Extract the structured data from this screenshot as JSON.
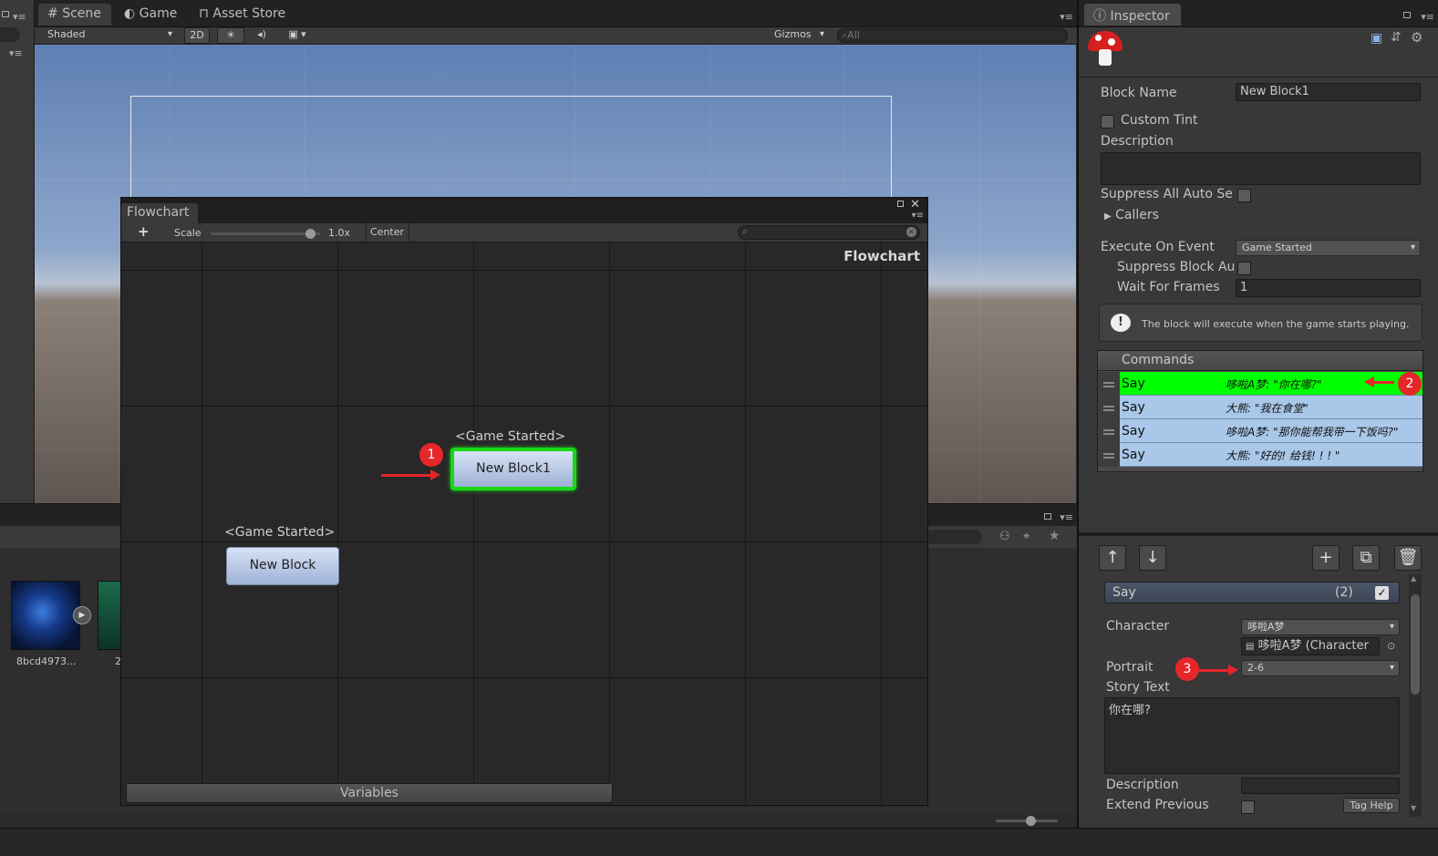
{
  "scene_window": {
    "tabs": [
      "Scene",
      "Game",
      "Asset Store"
    ],
    "shading_mode": "Shaded",
    "mode_2d": "2D",
    "gizmos_label": "Gizmos",
    "search_placeholder": "All"
  },
  "flowchart_window": {
    "tab": "Flowchart",
    "add_button": "+",
    "scale_label": "Scale",
    "scale_value": "1.0x",
    "scale_fraction": 0.95,
    "center_button": "Center",
    "corner_title": "Flowchart",
    "variables_button": "Variables",
    "blocks": [
      {
        "event": "<Game Started>",
        "name": "New Block1",
        "selected": true
      },
      {
        "event": "<Game Started>",
        "name": "New Block",
        "selected": false
      }
    ]
  },
  "project_panel": {
    "assets": [
      {
        "label": "8bcd4973..."
      },
      {
        "label": "2"
      }
    ]
  },
  "inspector": {
    "tab": "Inspector",
    "block_name_label": "Block Name",
    "block_name_value": "New Block1",
    "custom_tint_label": "Custom Tint",
    "description_label": "Description",
    "suppress_all_label": "Suppress All Auto Se",
    "callers_label": "Callers",
    "execute_on_event_label": "Execute On Event",
    "execute_on_event_value": "Game Started",
    "suppress_block_label": "Suppress Block Au",
    "wait_for_frames_label": "Wait For Frames",
    "wait_for_frames_value": "1",
    "help_text": "The block will execute when the game starts playing.",
    "commands_header": "Commands",
    "commands": [
      {
        "name": "Say",
        "summary": "哆啦A梦: \"你在哪?\"",
        "selected": true
      },
      {
        "name": "Say",
        "summary": "大熊: \"我在食堂\"",
        "selected": false
      },
      {
        "name": "Say",
        "summary": "哆啦A梦: \"那你能帮我带一下饭吗?\"",
        "selected": false
      },
      {
        "name": "Say",
        "summary": "大熊: \"好的! 给钱! ! ! \"",
        "selected": false
      }
    ],
    "say_panel": {
      "title": "Say",
      "index": "(2)",
      "character_label": "Character",
      "character_value": "哆啦A梦",
      "character_object": "哆啦A梦 (Character",
      "portrait_label": "Portrait",
      "portrait_value": "2-6",
      "story_text_label": "Story Text",
      "story_text_value": "你在哪?",
      "description_label": "Description",
      "extend_previous_label": "Extend Previous",
      "tag_help_button": "Tag Help"
    }
  },
  "annotations": [
    "1",
    "2",
    "3"
  ],
  "colors": {
    "selected_green": "#00ff00",
    "command_blue": "#a9c7e8",
    "marker_red": "#e6262b"
  }
}
